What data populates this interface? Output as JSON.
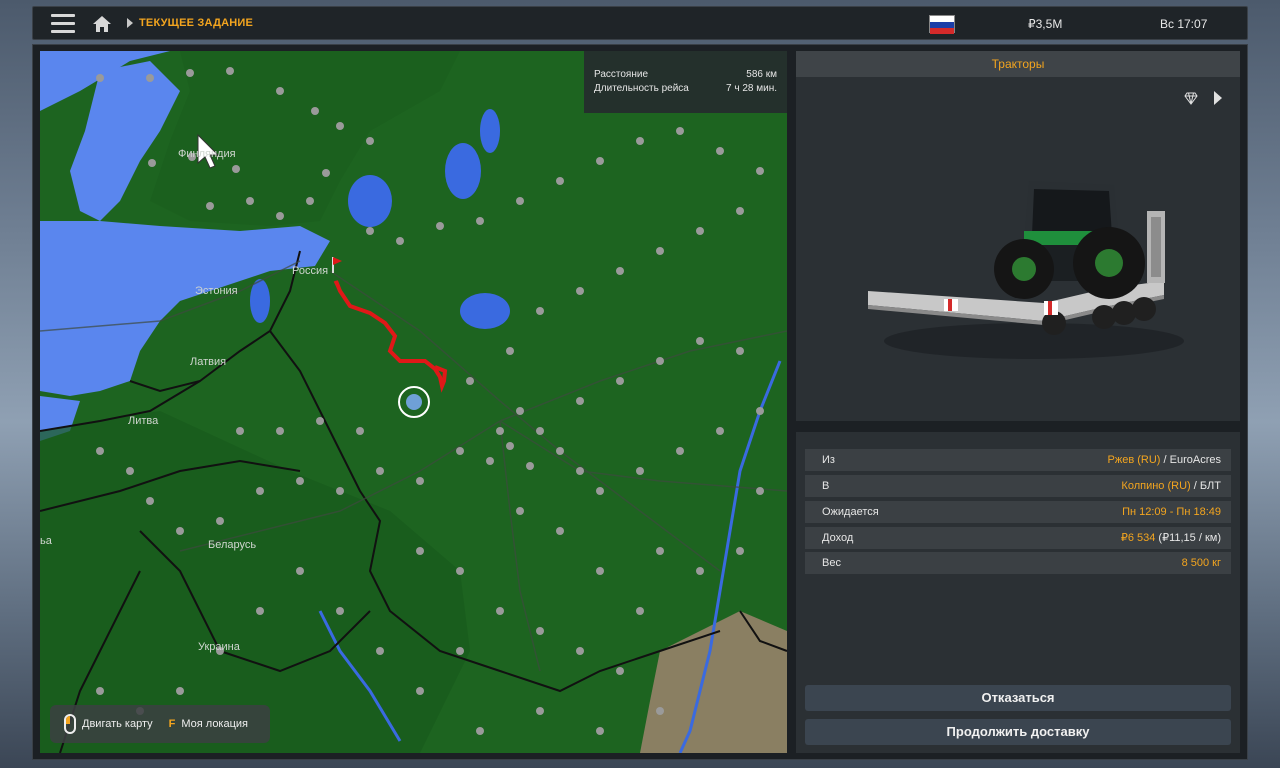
{
  "topbar": {
    "breadcrumb": "ТЕКУЩЕЕ ЗАДАНИЕ",
    "money": "₽3,5M",
    "clock": "Вс 17:07",
    "flag_colors": [
      "#ffffff",
      "#1c3ea8",
      "#d42a2a"
    ]
  },
  "map": {
    "info": {
      "distance_label": "Расстояние",
      "distance_value": "586 км",
      "duration_label": "Длительность рейса",
      "duration_value": "7 ч 28 мин."
    },
    "labels": {
      "finland": "Финляндия",
      "russia": "Россия",
      "estonia": "Эстония",
      "latvia": "Латвия",
      "lithuania": "Литва",
      "belarus": "Беларусь",
      "ukraine": "Украина",
      "poland_fragment": "ьа"
    },
    "controls": {
      "move_map": "Двигать карту",
      "key": "F",
      "my_location": "Моя локация"
    },
    "colors": {
      "land": "#1d6420",
      "water": "#5a86ee",
      "route": "#e01818"
    }
  },
  "cargo": {
    "title": "Тракторы"
  },
  "details": {
    "from_label": "Из",
    "from_city": "Ржев (RU)",
    "from_company": " / EuroAcres",
    "to_label": "В",
    "to_city": "Колпино (RU)",
    "to_company": " / БЛТ",
    "expected_label": "Ожидается",
    "expected_value": "Пн 12:09 - Пн 18:49",
    "income_label": "Доход",
    "income_value": "₽6 534",
    "income_rate": " (₽11,15 / км)",
    "weight_label": "Вес",
    "weight_value": "8 500 кг"
  },
  "buttons": {
    "decline": "Отказаться",
    "continue": "Продолжить доставку"
  }
}
